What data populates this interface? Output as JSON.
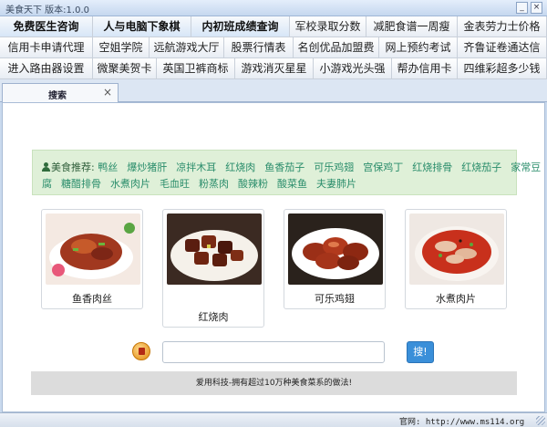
{
  "window": {
    "title": "美食天下 版本:1.0.0",
    "minimize": "_",
    "close": "×"
  },
  "links": [
    [
      "免费医生咨询",
      "人与电脑下象棋",
      "内初班成绩查询",
      "军校录取分数",
      "减肥食谱一周瘦",
      "金表劳力士价格"
    ],
    [
      "信用卡申请代理",
      "空姐学院",
      "远航游戏大厅",
      "股票行情表",
      "名创优品加盟费",
      "网上预约考试",
      "齐鲁证卷通达信"
    ],
    [
      "进入路由器设置",
      "微聚美贺卡",
      "英国卫裤商标",
      "游戏消灭星星",
      "小游戏光头强",
      "帮办信用卡",
      "四维彩超多少钱"
    ]
  ],
  "tab": {
    "label": "搜索",
    "close": "×"
  },
  "recommend": {
    "label": "美食推荐:",
    "line1": [
      "鸭丝",
      "爆炒猪肝",
      "凉拌木耳",
      "红烧肉",
      "鱼香茄子",
      "可乐鸡翅",
      "宫保鸡丁",
      "红烧排骨",
      "红烧茄子",
      "家常豆"
    ],
    "line2": [
      "腐",
      "糖醋排骨",
      "水煮肉片",
      "毛血旺",
      "粉蒸肉",
      "酸辣粉",
      "酸菜鱼",
      "夫妻肺片"
    ]
  },
  "dishes": [
    {
      "name": "鱼香肉丝"
    },
    {
      "name": "红烧肉"
    },
    {
      "name": "可乐鸡翅"
    },
    {
      "name": "水煮肉片"
    }
  ],
  "search": {
    "value": "",
    "button": "搜!"
  },
  "footer": "爱用科技-拥有超过10万种美食菜系的做法!",
  "status": {
    "site": "官网: http://www.ms114.org"
  }
}
